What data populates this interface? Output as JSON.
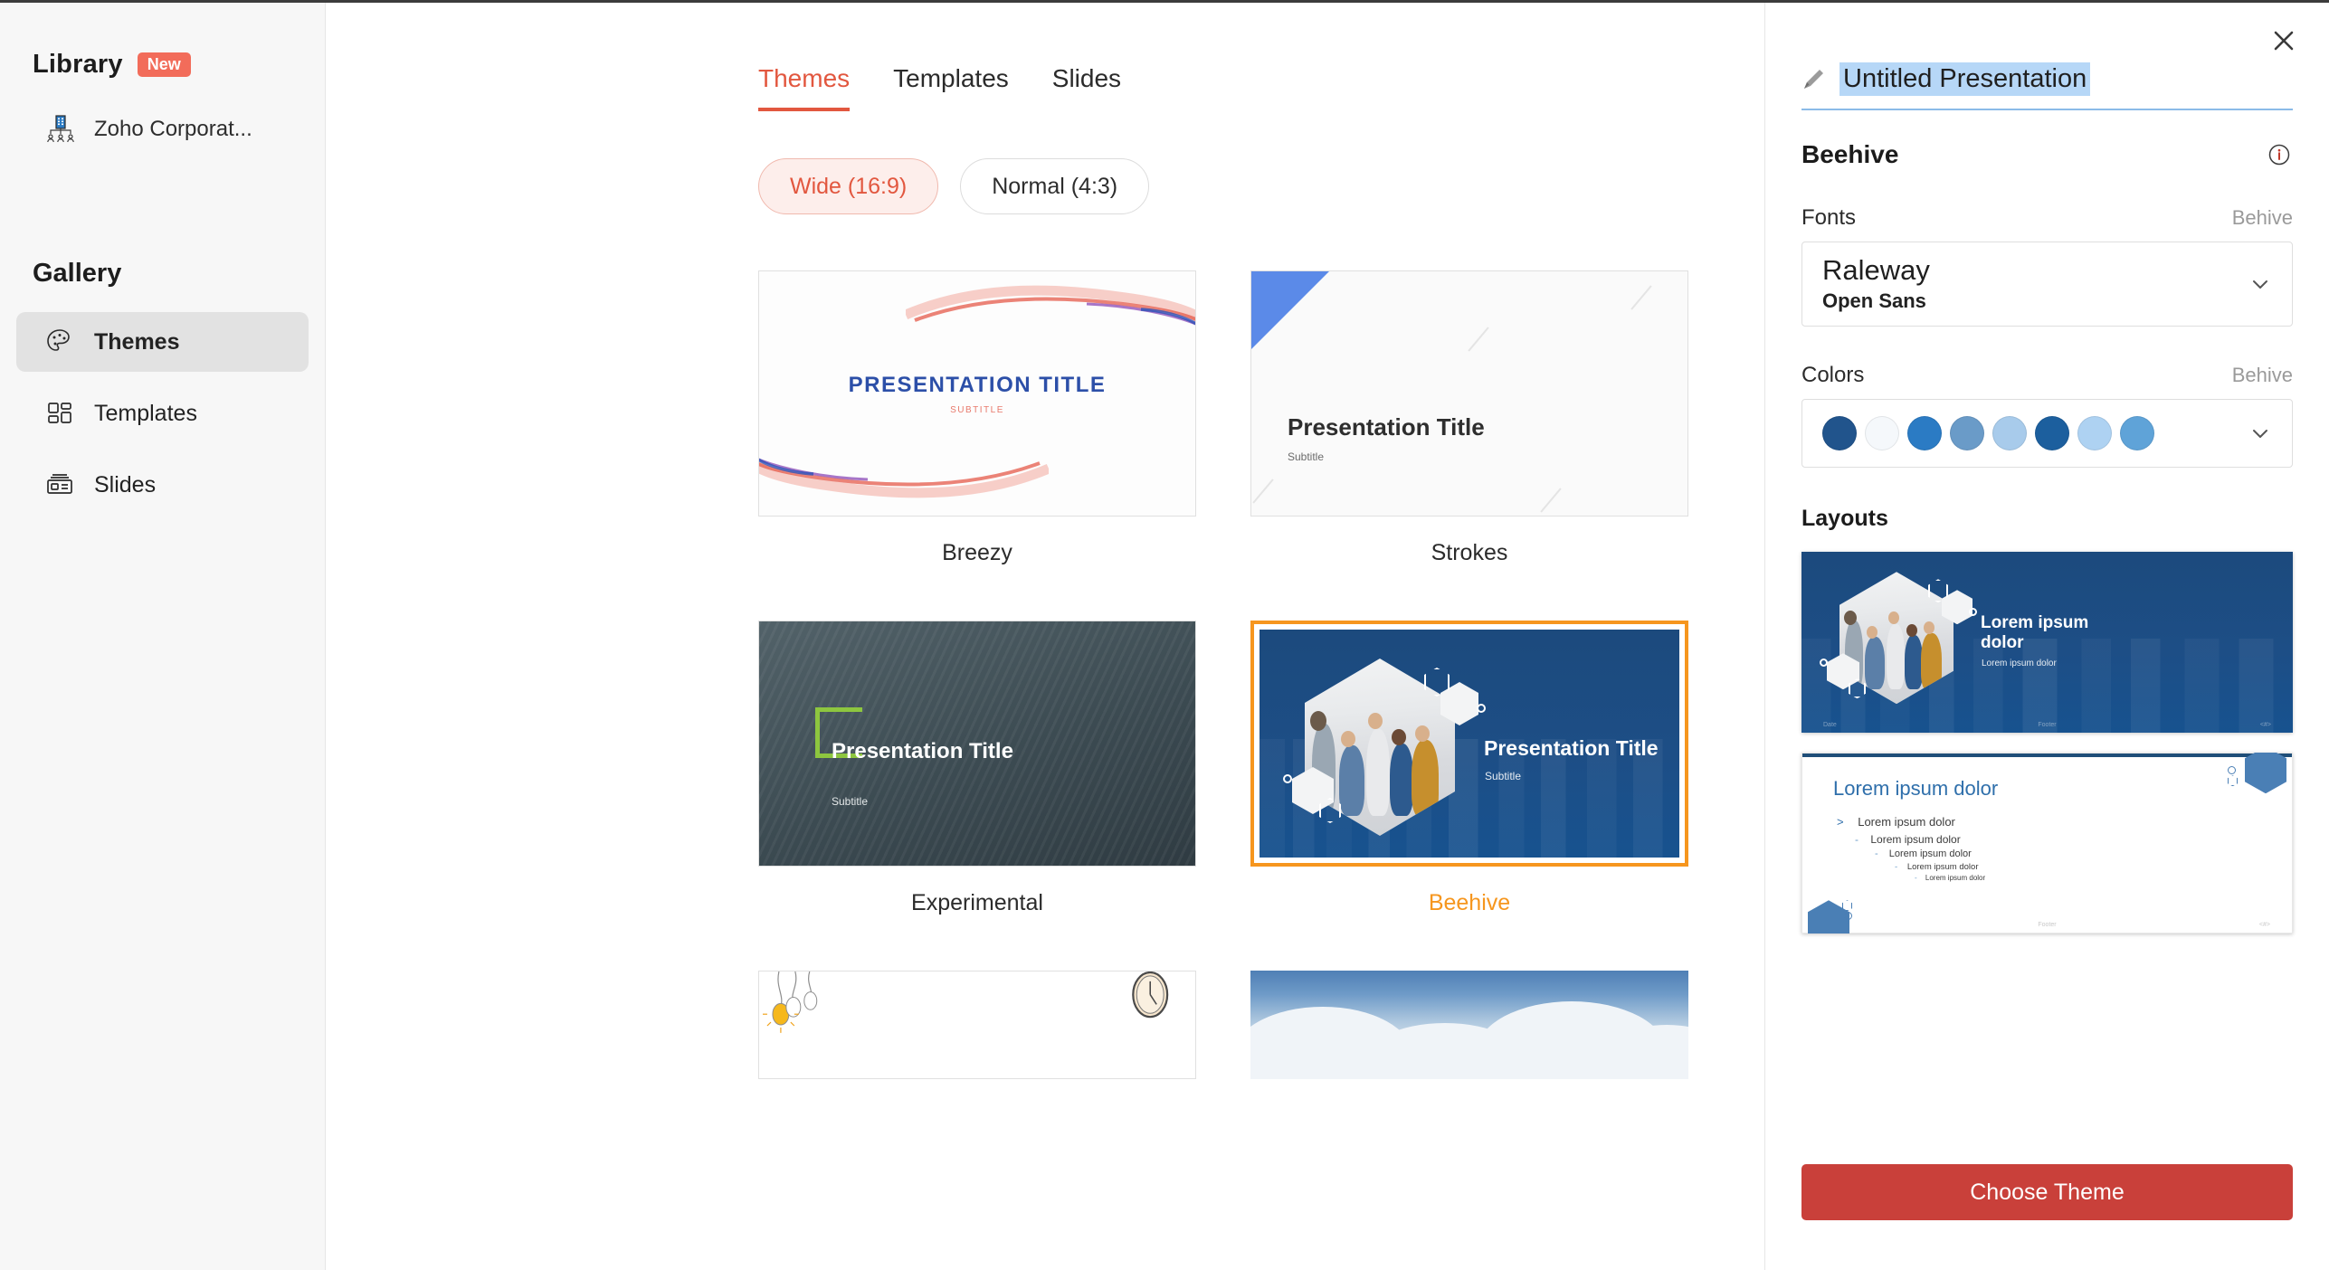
{
  "sidebar": {
    "library": {
      "title": "Library",
      "badge": "New"
    },
    "library_items": [
      {
        "label": "Zoho Corporat...",
        "icon": "org-chart-icon"
      }
    ],
    "gallery": {
      "title": "Gallery"
    },
    "nav_items": [
      {
        "label": "Themes",
        "icon": "palette-icon",
        "active": true
      },
      {
        "label": "Templates",
        "icon": "layout-blocks-icon",
        "active": false
      },
      {
        "label": "Slides",
        "icon": "slide-card-icon",
        "active": false
      }
    ]
  },
  "main": {
    "tabs": [
      {
        "label": "Themes",
        "active": true
      },
      {
        "label": "Templates",
        "active": false
      },
      {
        "label": "Slides",
        "active": false
      }
    ],
    "ratio_filters": [
      {
        "label": "Wide (16:9)",
        "active": true
      },
      {
        "label": "Normal (4:3)",
        "active": false
      }
    ],
    "themes": [
      {
        "name": "Breezy",
        "selected": false,
        "slide_title": "PRESENTATION TITLE",
        "slide_subtitle": "SUBTITLE"
      },
      {
        "name": "Strokes",
        "selected": false,
        "slide_title": "Presentation Title",
        "slide_subtitle": "Subtitle"
      },
      {
        "name": "Experimental",
        "selected": false,
        "slide_title": "Presentation Title",
        "slide_subtitle": "Subtitle"
      },
      {
        "name": "Beehive",
        "selected": true,
        "slide_title": "Presentation Title",
        "slide_subtitle": "Subtitle"
      }
    ]
  },
  "panel": {
    "close_icon": "close-icon",
    "edit_icon": "pencil-icon",
    "presentation_title": "Untitled Presentation",
    "theme_name": "Beehive",
    "info_icon": "info-icon",
    "fonts": {
      "label": "Fonts",
      "hint": "Behive",
      "heading_font": "Raleway",
      "body_font": "Open Sans"
    },
    "colors": {
      "label": "Colors",
      "hint": "Behive",
      "swatches": [
        "#21548c",
        "#f5f8fb",
        "#2b7bc4",
        "#6a9bc8",
        "#a8cbeb",
        "#1c5f9e",
        "#aed2f2",
        "#5fa3d8"
      ]
    },
    "layouts": {
      "label": "Layouts",
      "title_slide": {
        "title": "Lorem ipsum dolor",
        "subtitle": "Lorem ipsum dolor",
        "footer_date": "Date",
        "footer_center": "Footer",
        "footer_page": "<#>"
      },
      "content_slide": {
        "title": "Lorem ipsum dolor",
        "bullets": [
          "Lorem ipsum dolor",
          "Lorem ipsum dolor",
          "Lorem ipsum dolor",
          "Lorem ipsum dolor",
          "Lorem ipsum dolor"
        ],
        "footer_center": "Footer",
        "footer_page": "<#>"
      }
    },
    "choose_button": "Choose Theme"
  },
  "colors": {
    "accent_red": "#e2573f",
    "selected_orange": "#f6961e",
    "button_red": "#c9403a",
    "badge_red": "#f26c5a",
    "theme_blue": "#1c4a7d"
  }
}
